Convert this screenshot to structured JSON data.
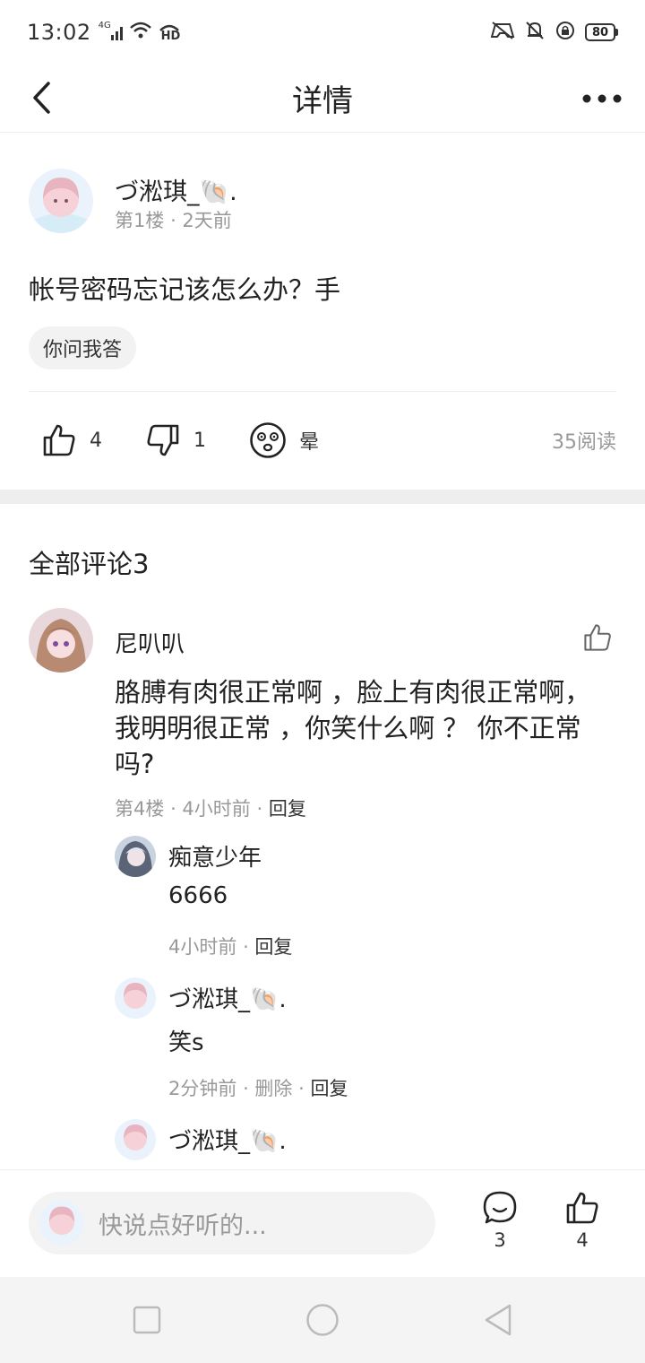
{
  "status_bar": {
    "time": "13:02",
    "network": "4G",
    "hd_label": "HD",
    "battery": "80"
  },
  "header": {
    "title": "详情"
  },
  "post": {
    "author": "づ淞琪_🐚.",
    "floor": "第1楼",
    "time": "2天前",
    "text": "帐号密码忘记该怎么办？手",
    "tag": "你问我答",
    "likes": "4",
    "dislikes": "1",
    "emotion_label": "晕",
    "read_count": "35阅读"
  },
  "comments_section": {
    "title": "全部评论3",
    "comment": {
      "author": "尼叭叭",
      "text": "胳膊有肉很正常啊 ，脸上有肉很正常啊， 我明明很正常 ，你笑什么啊 ？ 你不正常吗?",
      "floor": "第4楼",
      "time": "4小时前",
      "reply_label": "回复"
    },
    "replies": [
      {
        "author": "痴意少年",
        "text": "6666",
        "time": "4小时前",
        "delete_label": "",
        "reply_label": "回复"
      },
      {
        "author": "づ淞琪_🐚.",
        "text": "笑s",
        "time": "2分钟前",
        "delete_label": "删除",
        "reply_label": "回复"
      },
      {
        "author": "づ淞琪_🐚.",
        "text": "",
        "time": "",
        "delete_label": "",
        "reply_label": ""
      }
    ]
  },
  "bottom_bar": {
    "placeholder": "快说点好听的...",
    "comment_count": "3",
    "like_count": "4"
  },
  "colors": {
    "text": "#222222",
    "secondary_text": "#999999",
    "divider": "#eeeeee"
  }
}
